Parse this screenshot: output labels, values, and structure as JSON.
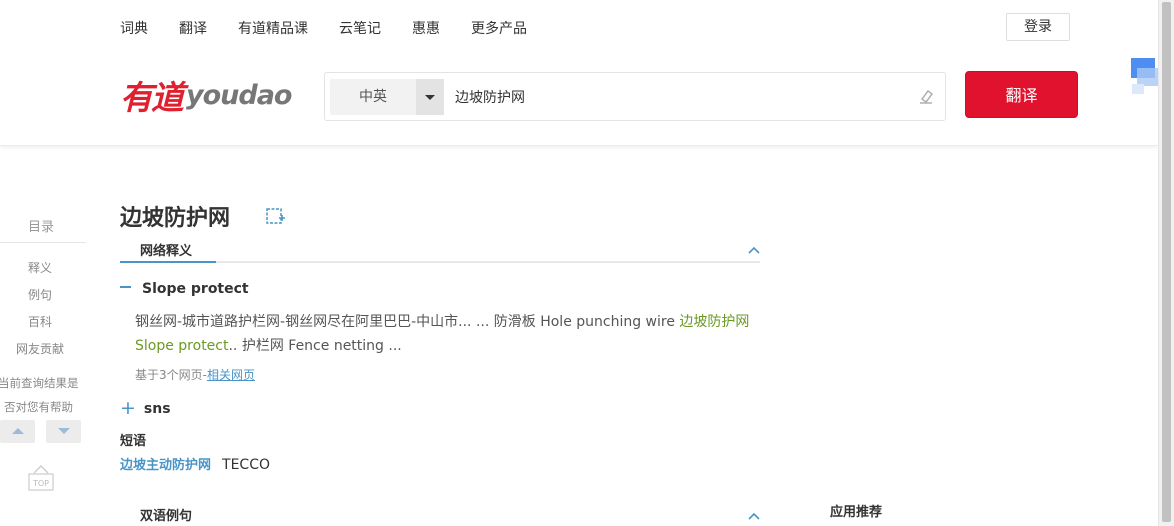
{
  "nav": {
    "items": [
      "词典",
      "翻译",
      "有道精品课",
      "云笔记",
      "惠惠",
      "更多产品"
    ],
    "login": "登录"
  },
  "logo": {
    "cn": "有道",
    "en": "youdao"
  },
  "search": {
    "lang": "中英",
    "query": "边坡防护网",
    "button": "翻译"
  },
  "sidebar": {
    "title": "目录",
    "items": [
      "释义",
      "例句",
      "百科",
      "网友贡献"
    ],
    "feedback_line1": "当前查询结果是",
    "feedback_line2": "否对您有帮助",
    "top_label": "TOP"
  },
  "entry": {
    "word": "边坡防护网",
    "tab_web": "网络释义",
    "sense1_title": "Slope protect",
    "sense1_text_a": "钢丝网-城市道路护栏网-钢丝网尽在阿里巴巴-中山市... ... 防滑板 Hole punching wire ",
    "sense1_hl_a": "边坡防护网",
    "sense1_hl_b": "Slope protect",
    "sense1_text_b": ".. 护栏网 Fence netting ...",
    "source_prefix": "基于3个网页-",
    "source_link": "相关网页",
    "sense2_title": "sns",
    "sense2_symbol": "+",
    "phrase_title": "短语",
    "phrase_cn": "边坡主动防护网",
    "phrase_en": "TECCO",
    "bilingual_label": "双语例句",
    "app_rec": "应用推荐"
  },
  "colors": {
    "brand_red": "#e1122d",
    "link_blue": "#4a94c8",
    "highlight_green": "#6b9a23"
  }
}
